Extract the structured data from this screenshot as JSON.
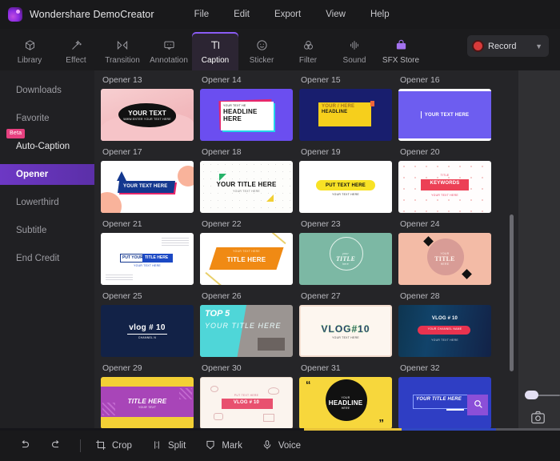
{
  "window": {
    "app_title": "Wondershare DemoCreator",
    "logo_icon": "democreator-logo-icon",
    "menu": [
      "File",
      "Edit",
      "Export",
      "View",
      "Help"
    ]
  },
  "toolbar": {
    "tabs": [
      {
        "label": "Library",
        "icon": "cube-icon",
        "active": false
      },
      {
        "label": "Effect",
        "icon": "magic-wand-icon",
        "active": false
      },
      {
        "label": "Transition",
        "icon": "transition-icon",
        "active": false
      },
      {
        "label": "Annotation",
        "icon": "comment-icon",
        "active": false
      },
      {
        "label": "Caption",
        "icon": "text-t-icon",
        "active": true
      },
      {
        "label": "Sticker",
        "icon": "smiley-icon",
        "active": false
      },
      {
        "label": "Filter",
        "icon": "three-circles-icon",
        "active": false
      },
      {
        "label": "Sound",
        "icon": "waveform-icon",
        "active": false
      },
      {
        "label": "SFX Store",
        "icon": "store-bag-icon",
        "active": false
      }
    ],
    "record": {
      "label": "Record",
      "dot_icon": "record-dot-icon",
      "chevron_icon": "chevron-down-icon",
      "dot_color": "#d83a3a"
    }
  },
  "sidebar": {
    "items": [
      {
        "label": "Downloads",
        "active": false,
        "badge": null
      },
      {
        "label": "Favorite",
        "active": false,
        "badge": null
      },
      {
        "label": "Auto-Caption",
        "active": false,
        "badge": "Beta"
      },
      {
        "label": "Opener",
        "active": true,
        "badge": null
      },
      {
        "label": "Lowerthird",
        "active": false,
        "badge": null
      },
      {
        "label": "Subtitle",
        "active": false,
        "badge": null
      },
      {
        "label": "End Credit",
        "active": false,
        "badge": null
      }
    ],
    "active_color": "#6d38c4",
    "badge_color": "#e6407f"
  },
  "content": {
    "scrollbar": "vertical-scrollbar",
    "templates": [
      {
        "name": "Opener 13",
        "style": "t13",
        "text": "YOUR TEXT",
        "sub": "WWW.ENTER YOUR TEXT HERE"
      },
      {
        "name": "Opener 14",
        "style": "t14",
        "text": "HEADLINE HERE",
        "sub": "YOUR TEXT HE"
      },
      {
        "name": "Opener 15",
        "style": "t15",
        "text": "HEADLINE",
        "sub": "YOUR / HERE"
      },
      {
        "name": "Opener 16",
        "style": "t16",
        "text": "YOUR TEXT HERE",
        "sub": ""
      },
      {
        "name": "Opener 17",
        "style": "t17",
        "text": "YOUR TEXT HERE",
        "sub": ""
      },
      {
        "name": "Opener 18",
        "style": "t18",
        "text": "YOUR TITLE HERE",
        "sub": "YOUR TEXT HERE"
      },
      {
        "name": "Opener 19",
        "style": "t19",
        "text": "PUT TEXT HERE",
        "sub": "YOUR TEXT HERE"
      },
      {
        "name": "Opener 20",
        "style": "t20",
        "text": "KEYWORDS",
        "sub": "YOUR TEXT HERE",
        "top": "TITLE"
      },
      {
        "name": "Opener 21",
        "style": "t21",
        "text": "TITLE HERE",
        "sub": "YOUR TEXT HERE",
        "pre": "PUT YOUR"
      },
      {
        "name": "Opener 22",
        "style": "t22",
        "text": "TITLE HERE",
        "sub": "YOUR TEXT HERE"
      },
      {
        "name": "Opener 23",
        "style": "t23",
        "text": "TITLE",
        "sub": "here",
        "pre": "your"
      },
      {
        "name": "Opener 24",
        "style": "t24",
        "text": "TITLE",
        "sub": "HERE",
        "pre": "YOUR"
      },
      {
        "name": "Opener 25",
        "style": "t25",
        "text": "vlog # 10",
        "sub": "CHANNEL N"
      },
      {
        "name": "Opener 26",
        "style": "t26",
        "text": "YOUR TITLE HERE",
        "sub": "",
        "pre": "TOP 5"
      },
      {
        "name": "Opener 27",
        "style": "t27",
        "text": "VLOG#10",
        "sub": "YOUR TEXT HERE"
      },
      {
        "name": "Opener 28",
        "style": "t28",
        "text": "VLOG # 10",
        "sub": "YOUR TEXT HERE",
        "pre": "YOUR CHANNEL NAME"
      },
      {
        "name": "Opener 29",
        "style": "t29",
        "text": "TITLE HERE",
        "sub": "YOUR TEXT"
      },
      {
        "name": "Opener 30",
        "style": "t30",
        "text": "VLOG # 10",
        "sub": "PUT TEXT HERE"
      },
      {
        "name": "Opener 31",
        "style": "t31",
        "text": "HEADLINE",
        "sub": "HERE",
        "pre": "YOUR"
      },
      {
        "name": "Opener 32",
        "style": "t32",
        "text": "YOUR TITLE HERE",
        "sub": ""
      }
    ]
  },
  "preview_panel": {
    "zoom_slider_value": 5,
    "snapshot_icon": "camera-icon"
  },
  "bottombar": {
    "buttons": [
      {
        "label": "",
        "icon": "undo-icon"
      },
      {
        "label": "",
        "icon": "redo-icon"
      },
      {
        "label": "Crop",
        "icon": "crop-icon"
      },
      {
        "label": "Split",
        "icon": "split-icon"
      },
      {
        "label": "Mark",
        "icon": "shield-mark-icon"
      },
      {
        "label": "Voice",
        "icon": "microphone-icon"
      }
    ]
  }
}
